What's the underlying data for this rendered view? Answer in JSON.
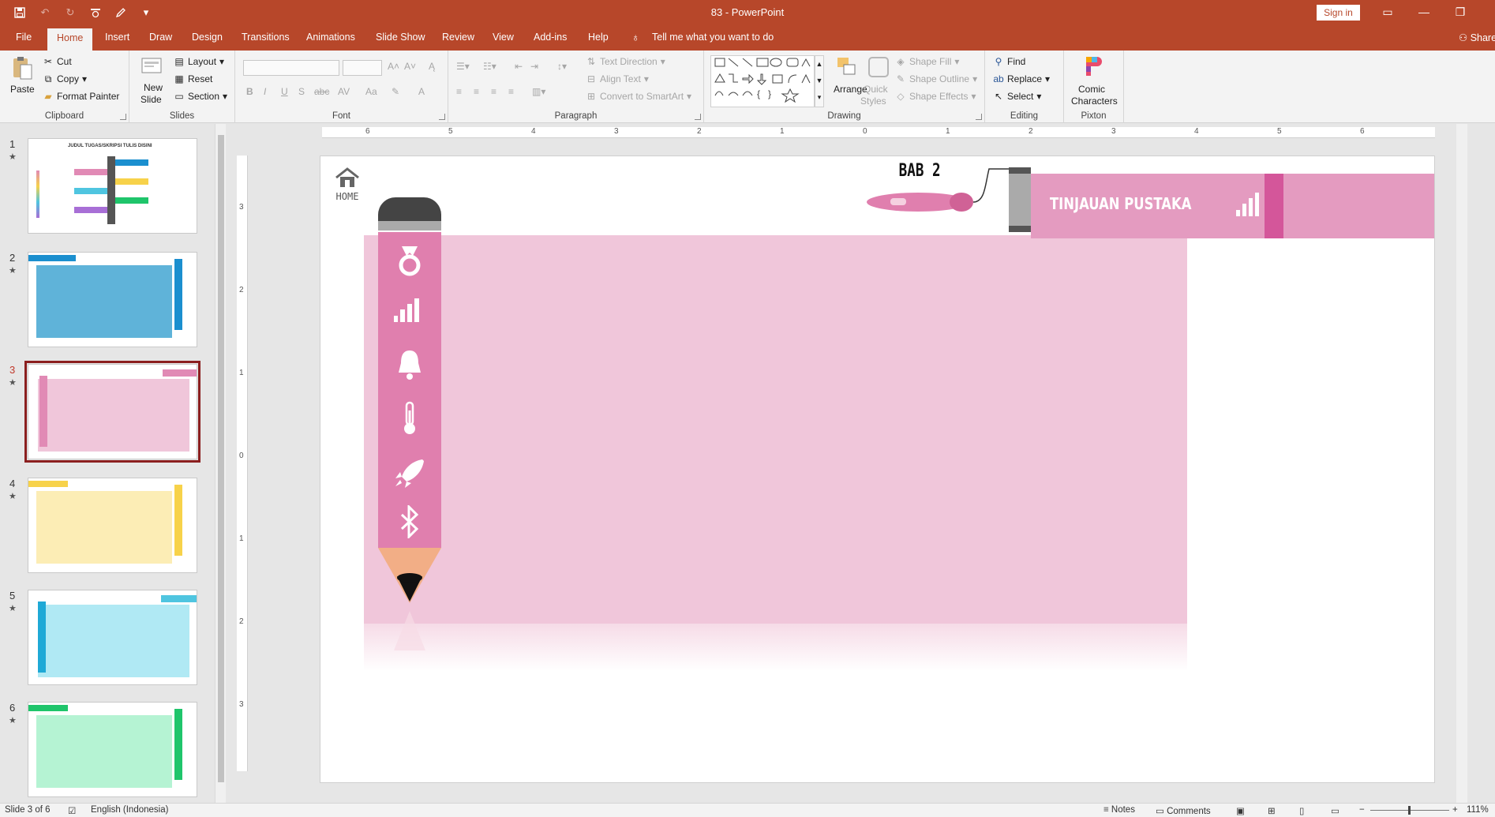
{
  "window": {
    "title": "83  -  PowerPoint",
    "sign_in": "Sign in",
    "qat": [
      "save-icon",
      "undo-icon",
      "redo-icon",
      "touch-mode-icon",
      "draw-icon",
      "customize-icon"
    ]
  },
  "tabs": [
    "File",
    "Home",
    "Insert",
    "Draw",
    "Design",
    "Transitions",
    "Animations",
    "Slide Show",
    "Review",
    "View",
    "Add-ins",
    "Help"
  ],
  "active_tab": "Home",
  "tell_me": "Tell me what you want to do",
  "share": "Share",
  "ribbon": {
    "clipboard": {
      "label": "Clipboard",
      "paste": "Paste",
      "cut": "Cut",
      "copy": "Copy",
      "format_painter": "Format Painter"
    },
    "slides": {
      "label": "Slides",
      "new_slide_1": "New",
      "new_slide_2": "Slide",
      "layout": "Layout",
      "reset": "Reset",
      "section": "Section"
    },
    "font": {
      "label": "Font"
    },
    "paragraph": {
      "label": "Paragraph",
      "text_direction": "Text Direction",
      "align_text": "Align Text",
      "convert_smartart": "Convert to SmartArt"
    },
    "drawing": {
      "label": "Drawing",
      "arrange": "Arrange",
      "quick_styles_1": "Quick",
      "quick_styles_2": "Styles",
      "shape_fill": "Shape Fill",
      "shape_outline": "Shape Outline",
      "shape_effects": "Shape Effects"
    },
    "editing": {
      "label": "Editing",
      "find": "Find",
      "replace": "Replace",
      "select": "Select"
    },
    "pixton": {
      "label": "Pixton",
      "comic_1": "Comic",
      "comic_2": "Characters"
    }
  },
  "slides": [
    {
      "number": "1",
      "title": "JUDUL TUGAS/SKRIPSI TULIS DISINI",
      "color": "#ffffff"
    },
    {
      "number": "2",
      "color": "#5fb3d9"
    },
    {
      "number": "3",
      "color": "#f0c6da"
    },
    {
      "number": "4",
      "color": "#fcedb5"
    },
    {
      "number": "5",
      "color": "#b0e9f4"
    },
    {
      "number": "6",
      "color": "#b5f3d3"
    }
  ],
  "selected_slide": "3",
  "slide": {
    "home_label": "HOME",
    "bab_label": "BAB 2",
    "banner_text": "TINJAUAN PUSTAKA",
    "accent": "#e18ab5",
    "pencil_icons": [
      "medal-icon",
      "signal-bars-icon",
      "bell-icon",
      "thermometer-icon",
      "rocket-icon",
      "bluetooth-icon"
    ],
    "banner_icon": "signal-bars-icon"
  },
  "ruler": {
    "horizontal": [
      "6",
      "5",
      "4",
      "3",
      "2",
      "1",
      "0",
      "1",
      "2",
      "3",
      "4",
      "5",
      "6"
    ],
    "vertical": [
      "3",
      "2",
      "1",
      "0",
      "1",
      "2",
      "3"
    ]
  },
  "status": {
    "slide_of": "Slide 3 of 6",
    "language": "English (Indonesia)",
    "notes": "Notes",
    "comments": "Comments",
    "zoom": "111%"
  }
}
